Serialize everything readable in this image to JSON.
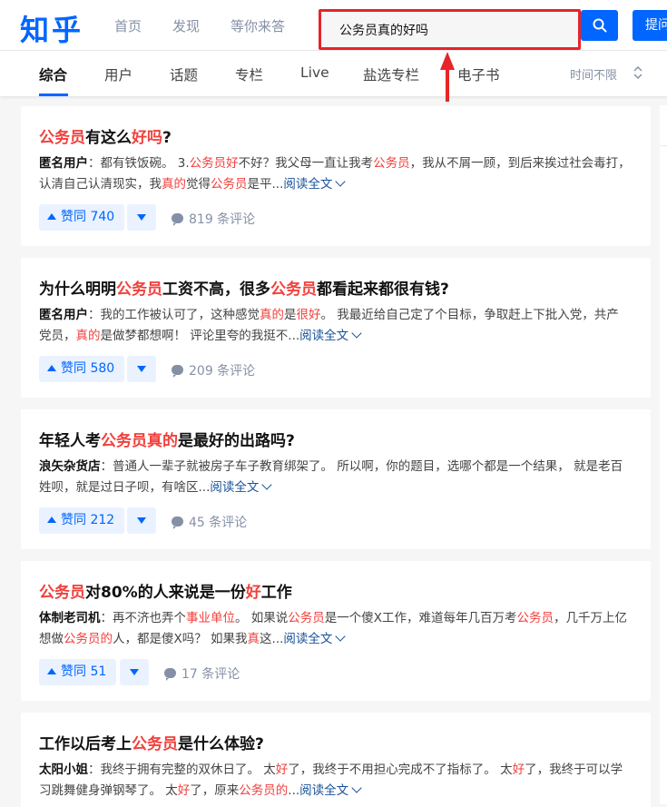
{
  "header": {
    "logo": "知乎",
    "nav": [
      "首页",
      "发现",
      "等你来答"
    ],
    "search_value": "公务员真的好吗",
    "ask_label": "提问"
  },
  "tabs": {
    "items": [
      "综合",
      "用户",
      "话题",
      "专栏",
      "Live",
      "盐选专栏",
      "电子书"
    ],
    "time_filter": "时间不限"
  },
  "results": [
    {
      "title": [
        {
          "t": "公务员",
          "hl": true
        },
        {
          "t": "有这么",
          "hl": false
        },
        {
          "t": "好吗",
          "hl": true
        },
        {
          "t": "?",
          "hl": false
        }
      ],
      "author": "匿名用户",
      "snippet": [
        {
          "t": "都有铁饭碗。 3.",
          "hl": false
        },
        {
          "t": "公务员好",
          "hl": true
        },
        {
          "t": "不好？我父母一直让我考",
          "hl": false
        },
        {
          "t": "公务员",
          "hl": true
        },
        {
          "t": "，我从不屑一顾，到后来挨过社会毒打，认清自己认清现实，我",
          "hl": false
        },
        {
          "t": "真的",
          "hl": true
        },
        {
          "t": "觉得",
          "hl": false
        },
        {
          "t": "公务员",
          "hl": true
        },
        {
          "t": "是平...",
          "hl": false
        }
      ],
      "read_more": "阅读全文",
      "upvote": "赞同 740",
      "comments": "819 条评论"
    },
    {
      "title": [
        {
          "t": "为什么明明",
          "hl": false
        },
        {
          "t": "公务员",
          "hl": true
        },
        {
          "t": "工资不高，很多",
          "hl": false
        },
        {
          "t": "公务员",
          "hl": true
        },
        {
          "t": "都看起来都很有钱?",
          "hl": false
        }
      ],
      "author": "匿名用户",
      "snippet": [
        {
          "t": "我的工作被认可了，这种感觉",
          "hl": false
        },
        {
          "t": "真的",
          "hl": true
        },
        {
          "t": "是",
          "hl": false
        },
        {
          "t": "很好",
          "hl": true
        },
        {
          "t": "。 我最近给自己定了个目标，争取赶上下批入党，共产党员，",
          "hl": false
        },
        {
          "t": "真的",
          "hl": true
        },
        {
          "t": "是做梦都想啊！ 评论里夸的我挺不...",
          "hl": false
        }
      ],
      "read_more": "阅读全文",
      "upvote": "赞同 580",
      "comments": "209 条评论"
    },
    {
      "title": [
        {
          "t": "年轻人考",
          "hl": false
        },
        {
          "t": "公务员真的",
          "hl": true
        },
        {
          "t": "是最好的出路吗?",
          "hl": false
        }
      ],
      "author": "浪矢杂货店",
      "snippet": [
        {
          "t": "普通人一辈子就被房子车子教育绑架了。 所以啊，你的题目，选哪个都是一个结果， 就是老百姓呗，就是过日子呗，有啥区...",
          "hl": false
        }
      ],
      "read_more": "阅读全文",
      "upvote": "赞同 212",
      "comments": "45 条评论"
    },
    {
      "title": [
        {
          "t": "公务员",
          "hl": true
        },
        {
          "t": "对80%的人来说是一份",
          "hl": false
        },
        {
          "t": "好",
          "hl": true
        },
        {
          "t": "工作",
          "hl": false
        }
      ],
      "author": "体制老司机",
      "snippet": [
        {
          "t": "再不济也弄个",
          "hl": false
        },
        {
          "t": "事业单位",
          "hl": true
        },
        {
          "t": "。 如果说",
          "hl": false
        },
        {
          "t": "公务员",
          "hl": true
        },
        {
          "t": "是一个傻X工作，难道每年几百万考",
          "hl": false
        },
        {
          "t": "公务员",
          "hl": true
        },
        {
          "t": "，几千万上亿想做",
          "hl": false
        },
        {
          "t": "公务员的",
          "hl": true
        },
        {
          "t": "人，都是傻X吗？ 如果我",
          "hl": false
        },
        {
          "t": "真",
          "hl": true
        },
        {
          "t": "这...",
          "hl": false
        }
      ],
      "read_more": "阅读全文",
      "upvote": "赞同 51",
      "comments": "17 条评论"
    },
    {
      "title": [
        {
          "t": "工作以后考上",
          "hl": false
        },
        {
          "t": "公务员",
          "hl": true
        },
        {
          "t": "是什么体验?",
          "hl": false
        }
      ],
      "author": "太阳小姐",
      "snippet": [
        {
          "t": "我终于拥有完整的双休日了。 太",
          "hl": false
        },
        {
          "t": "好",
          "hl": true
        },
        {
          "t": "了，我终于不用担心完成不了指标了。 太",
          "hl": false
        },
        {
          "t": "好",
          "hl": true
        },
        {
          "t": "了，我终于可以学习跳舞健身弹钢琴了。 太",
          "hl": false
        },
        {
          "t": "好",
          "hl": true
        },
        {
          "t": "了，原来",
          "hl": false
        },
        {
          "t": "公务员的",
          "hl": true
        },
        {
          "t": "...",
          "hl": false
        }
      ],
      "read_more": "阅读全文"
    }
  ],
  "colors": {
    "brand": "#0066ff",
    "highlight": "#f1403c",
    "annotation": "#e5252a",
    "link": "#175199"
  }
}
